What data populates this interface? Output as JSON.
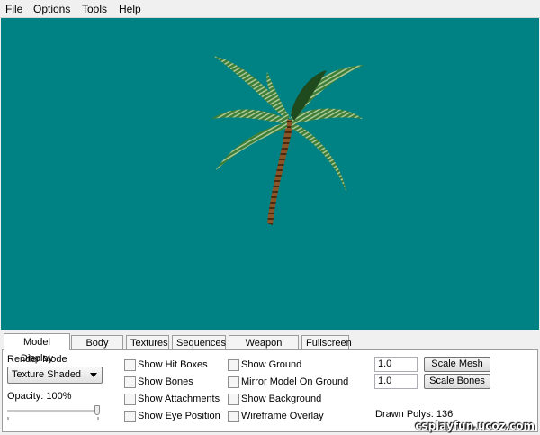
{
  "menubar": {
    "items": [
      "File",
      "Options",
      "Tools",
      "Help"
    ]
  },
  "tabs": [
    "Model Display",
    "Body Parts",
    "Textures",
    "Sequences",
    "Weapon Origin",
    "Fullscreen"
  ],
  "active_tab": "Model Display",
  "render_mode": {
    "label": "Render Mode",
    "value": "Texture Shaded"
  },
  "opacity": {
    "label": "Opacity: 100%",
    "value": 1.0
  },
  "checkboxes_col1": [
    "Show Hit Boxes",
    "Show Bones",
    "Show Attachments",
    "Show Eye Position"
  ],
  "checkboxes_col2": [
    "Show Ground",
    "Mirror Model On Ground",
    "Show Background",
    "Wireframe Overlay"
  ],
  "scale_mesh": {
    "value": "1.0",
    "button": "Scale Mesh"
  },
  "scale_bones": {
    "value": "1.0",
    "button": "Scale Bones"
  },
  "drawn_polys": "Drawn Polys: 136",
  "watermark": "csplayfun.ucoz.com",
  "colors": {
    "viewport_bg": "#008284",
    "leaf": "#3f7f35",
    "trunk": "#7a4a22"
  }
}
